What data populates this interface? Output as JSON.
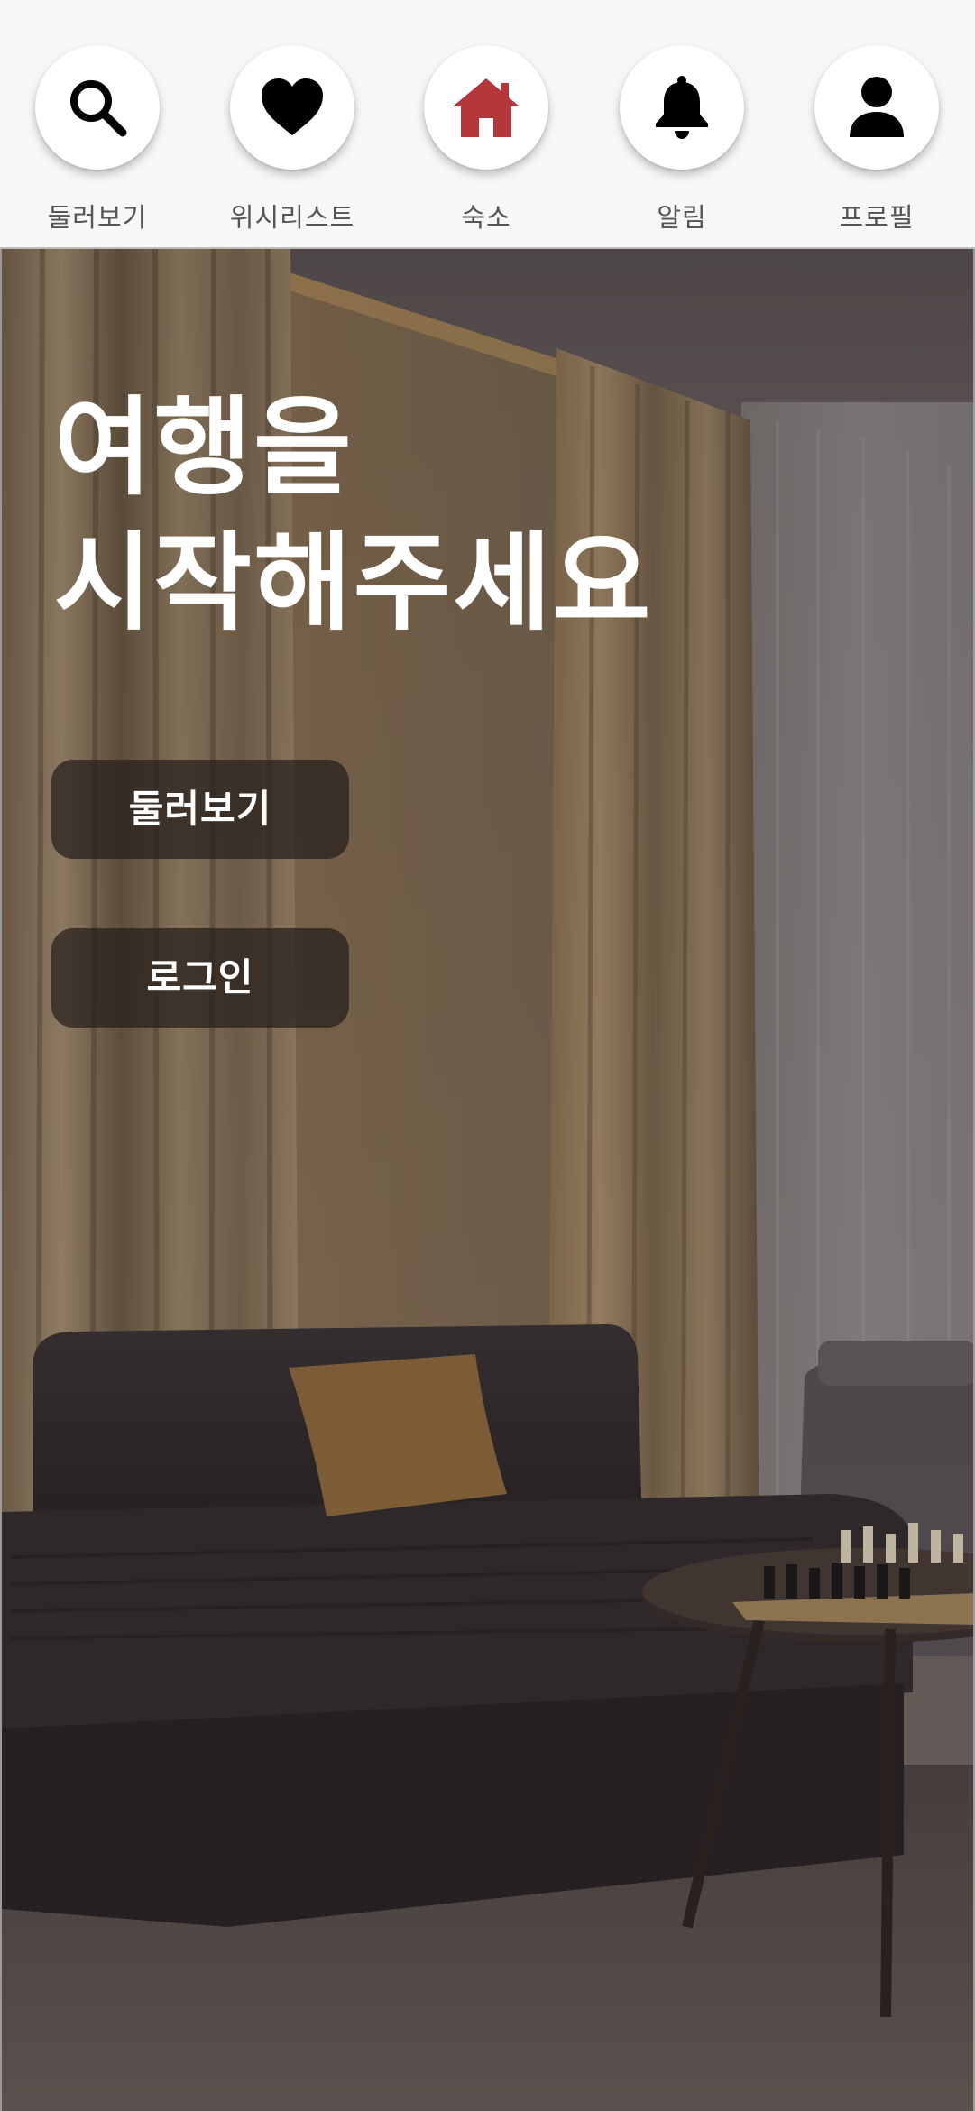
{
  "nav": {
    "items": [
      {
        "label": "둘러보기",
        "icon": "search-icon"
      },
      {
        "label": "위시리스트",
        "icon": "heart-icon"
      },
      {
        "label": "숙소",
        "icon": "home-icon",
        "active": true
      },
      {
        "label": "알림",
        "icon": "bell-icon"
      },
      {
        "label": "프로필",
        "icon": "user-icon"
      }
    ],
    "active_color": "#b3373b",
    "icon_color": "#000000"
  },
  "hero": {
    "title_line1": "여행을",
    "title_line2": "시작해주세요",
    "buttons": {
      "explore": "둘러보기",
      "login": "로그인"
    }
  }
}
